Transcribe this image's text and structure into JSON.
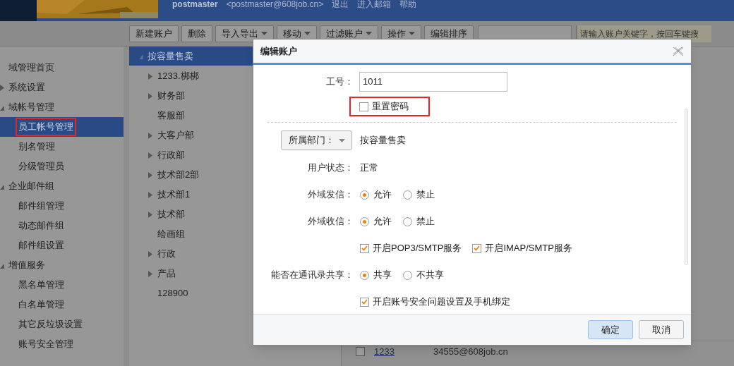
{
  "header": {
    "user": "postmaster",
    "email": "<postmaster@608job.cn>",
    "links": [
      "退出",
      "进入邮箱",
      "帮助"
    ]
  },
  "toolbar": {
    "buttons": [
      {
        "label": "新建账户",
        "dropdown": false
      },
      {
        "label": "删除",
        "dropdown": false
      },
      {
        "label": "导入导出",
        "dropdown": true
      },
      {
        "label": "移动",
        "dropdown": true
      },
      {
        "label": "过滤账户",
        "dropdown": true
      },
      {
        "label": "操作",
        "dropdown": true
      },
      {
        "label": "编辑排序",
        "dropdown": false
      }
    ],
    "search_hint": "请输入账户关键字，按回车键搜"
  },
  "sidebar": {
    "items": [
      {
        "label": "域管理首页",
        "selected": false,
        "highlighted": false
      },
      {
        "label": "系统设置",
        "selected": false,
        "highlighted": false,
        "expanded": false
      },
      {
        "label": "域帐号管理",
        "selected": false,
        "highlighted": false,
        "expanded": true,
        "children": [
          {
            "label": "员工帐号管理",
            "selected": true,
            "highlighted": true
          },
          {
            "label": "别名管理",
            "selected": false,
            "highlighted": false
          },
          {
            "label": "分级管理员",
            "selected": false,
            "highlighted": false
          }
        ]
      },
      {
        "label": "企业邮件组",
        "selected": false,
        "highlighted": false,
        "expanded": true,
        "children": [
          {
            "label": "邮件组管理",
            "selected": false,
            "highlighted": false
          },
          {
            "label": "动态邮件组",
            "selected": false,
            "highlighted": false
          },
          {
            "label": "邮件组设置",
            "selected": false,
            "highlighted": false
          }
        ]
      },
      {
        "label": "增值服务",
        "selected": false,
        "highlighted": false,
        "expanded": true,
        "children": [
          {
            "label": "黑名单管理",
            "selected": false,
            "highlighted": false
          },
          {
            "label": "白名单管理",
            "selected": false,
            "highlighted": false
          },
          {
            "label": "其它反垃圾设置",
            "selected": false,
            "highlighted": false
          },
          {
            "label": "账号安全管理",
            "selected": false,
            "highlighted": false
          }
        ]
      }
    ]
  },
  "department_tree": {
    "root": {
      "label": "按容量售卖",
      "selected": true,
      "expanded": true
    },
    "children": [
      {
        "label": "1233.梆梆",
        "has_children": true
      },
      {
        "label": "财务部",
        "has_children": true
      },
      {
        "label": "客服部",
        "has_children": false
      },
      {
        "label": "大客户部",
        "has_children": true
      },
      {
        "label": "行政部",
        "has_children": true
      },
      {
        "label": "技术部2部",
        "has_children": true
      },
      {
        "label": "技术部1",
        "has_children": true
      },
      {
        "label": "技术部",
        "has_children": true
      },
      {
        "label": "绘画组",
        "has_children": false
      },
      {
        "label": "行政",
        "has_children": true
      },
      {
        "label": "产品",
        "has_children": true
      },
      {
        "label": "128900",
        "has_children": false
      }
    ]
  },
  "account_list": {
    "rows": [
      {
        "checked": false,
        "name": "1233",
        "email": "34555@608job.cn"
      }
    ]
  },
  "dialog": {
    "title": "编辑账户",
    "rows": [
      {
        "kind": "input",
        "label": "工号：",
        "value": "1011"
      },
      {
        "kind": "checkbox",
        "items": [
          {
            "label": "重置密码",
            "checked": false,
            "highlighted": true
          }
        ]
      },
      {
        "kind": "divider"
      },
      {
        "kind": "dropdown",
        "button": "所属部门：",
        "value": "按容量售卖"
      },
      {
        "kind": "text",
        "label": "用户状态：",
        "value": "正常"
      },
      {
        "kind": "radio",
        "label": "外域发信：",
        "options": [
          {
            "label": "允许",
            "selected": true
          },
          {
            "label": "禁止",
            "selected": false
          }
        ]
      },
      {
        "kind": "radio",
        "label": "外域收信：",
        "options": [
          {
            "label": "允许",
            "selected": true
          },
          {
            "label": "禁止",
            "selected": false
          }
        ]
      },
      {
        "kind": "checkbox",
        "items": [
          {
            "label": "开启POP3/SMTP服务",
            "checked": true,
            "highlighted": false
          },
          {
            "label": "开启IMAP/SMTP服务",
            "checked": true,
            "highlighted": false
          }
        ]
      },
      {
        "kind": "radio",
        "label": "能否在通讯录共享：",
        "options": [
          {
            "label": "共享",
            "selected": true
          },
          {
            "label": "不共享",
            "selected": false
          }
        ]
      },
      {
        "kind": "checkbox",
        "items": [
          {
            "label": "开启账号安全问题设置及手机绑定",
            "checked": true,
            "highlighted": false
          }
        ]
      }
    ],
    "buttons": [
      {
        "label": "确定",
        "primary": true
      },
      {
        "label": "取消",
        "primary": false
      }
    ]
  }
}
